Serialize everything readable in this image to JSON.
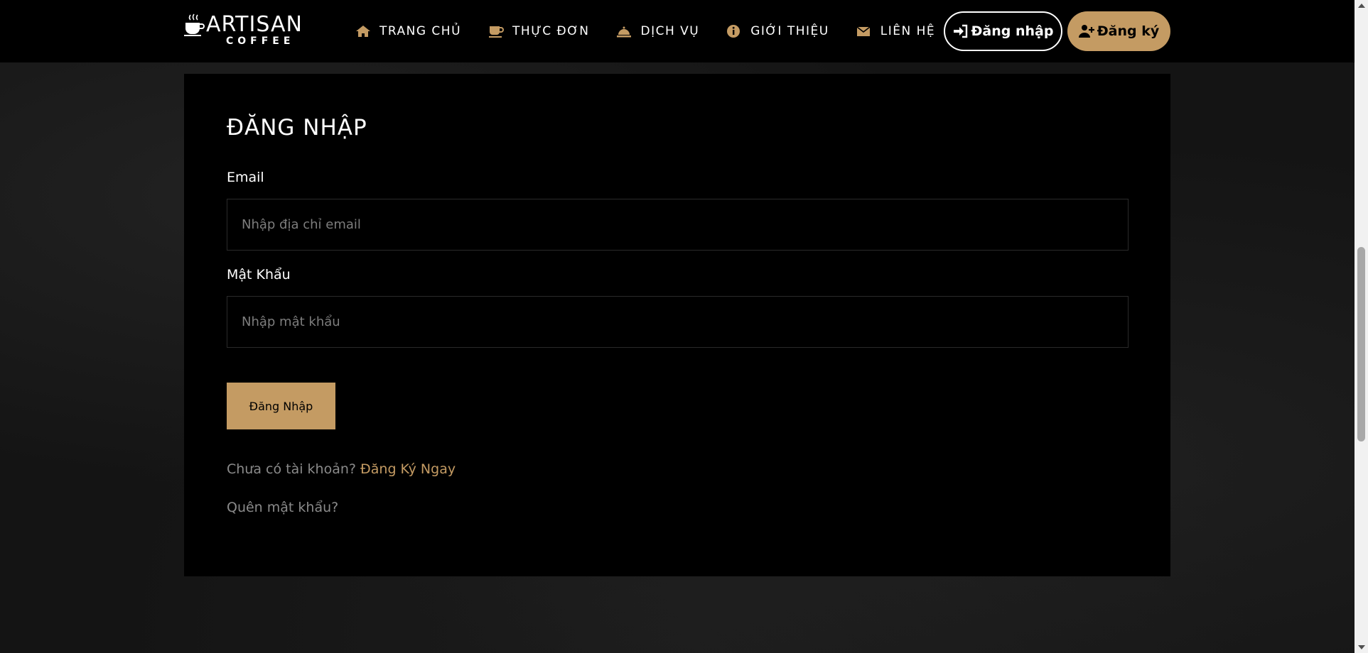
{
  "brand": {
    "name": "ARTISAN",
    "tagline": "COFFEE"
  },
  "nav": [
    {
      "label": "TRANG CHỦ",
      "icon": "home-icon"
    },
    {
      "label": "THỰC ĐƠN",
      "icon": "coffee-cup-icon"
    },
    {
      "label": "DỊCH VỤ",
      "icon": "service-bell-icon"
    },
    {
      "label": "GIỚI THIỆU",
      "icon": "info-icon"
    },
    {
      "label": "LIÊN HỆ",
      "icon": "envelope-icon"
    }
  ],
  "auth": {
    "login_label": "Đăng nhập",
    "register_label": "Đăng ký"
  },
  "form": {
    "title": "ĐĂNG NHẬP",
    "email_label": "Email",
    "email_placeholder": "Nhập địa chỉ email",
    "password_label": "Mật Khẩu",
    "password_placeholder": "Nhập mật khẩu",
    "submit_label": "Đăng Nhập",
    "no_account_text": "Chưa có tài khoản?",
    "signup_link": "Đăng Ký Ngay",
    "forgot_text": "Quên mật khẩu?"
  },
  "colors": {
    "accent": "#c49b63",
    "background": "#000000"
  }
}
